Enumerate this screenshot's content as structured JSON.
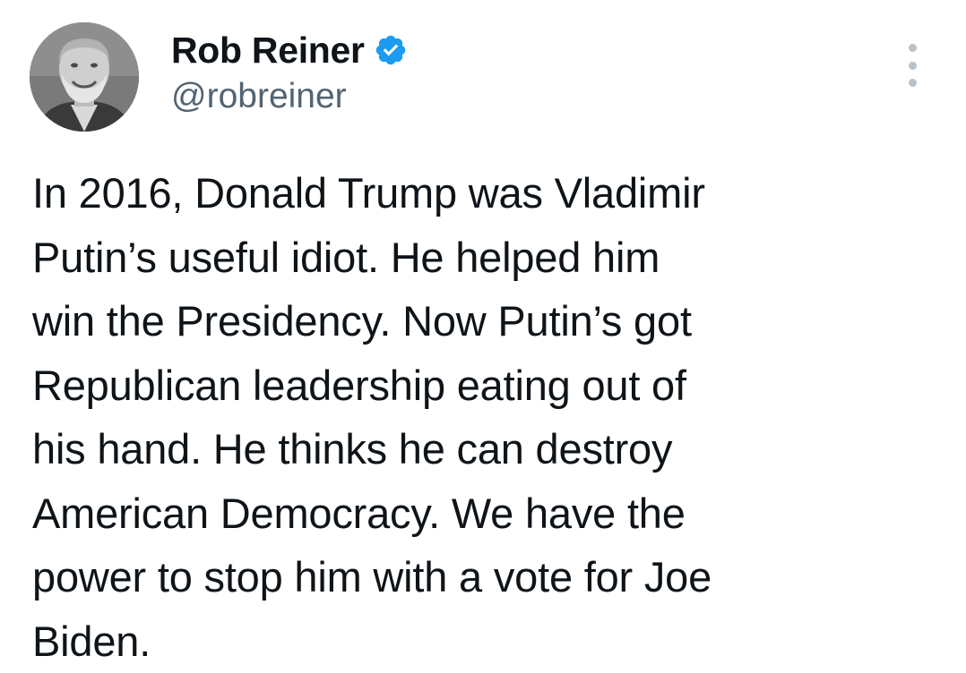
{
  "author": {
    "display_name": "Rob Reiner",
    "handle": "@robreiner",
    "verified": true,
    "avatar_icon": "profile-photo"
  },
  "tweet": {
    "lines": [
      "In 2016, Donald Trump was Vladimir",
      "Putin’s useful idiot. He helped him",
      "win the Presidency. Now Putin’s got",
      "Republican leadership eating out of",
      "his hand. He thinks he can destroy",
      "American Democracy. We have the",
      "power to stop him with a vote for Joe",
      "Biden."
    ]
  },
  "menu": {
    "icon": "more-vertical-icon"
  },
  "colors": {
    "verified_badge": "#1d9bf0",
    "text": "#0f1419",
    "handle": "#536471",
    "menu_dots": "#b9c2c9"
  }
}
